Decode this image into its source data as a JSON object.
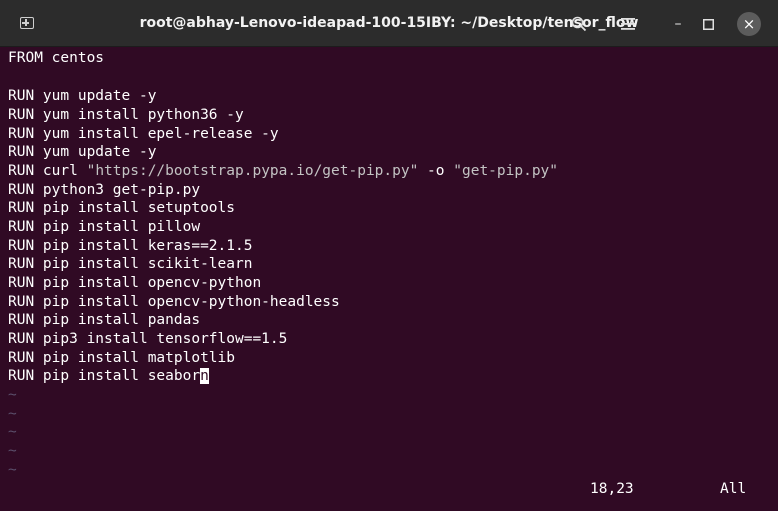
{
  "window": {
    "title": "root@abhay-Lenovo-ideapad-100-15IBY: ~/Desktop/tensor_flow",
    "close_glyph": "×",
    "minimize_glyph": "–",
    "maximize_glyph": "☐"
  },
  "icons": {
    "new_tab": "new-tab-icon",
    "search": "search-icon",
    "menu": "hamburger-menu-icon",
    "minimize": "minimize-icon",
    "maximize": "maximize-icon",
    "close": "close-icon"
  },
  "colors": {
    "terminal_bg": "#300a24",
    "titlebar_bg": "#2c2c2c",
    "string": "#c3c3c3",
    "tilde": "#5a4e6a"
  },
  "editor": {
    "lines": [
      {
        "kw": "FROM",
        "text": " centos"
      },
      {
        "kw": "",
        "text": ""
      },
      {
        "kw": "RUN",
        "text": " yum update -y"
      },
      {
        "kw": "RUN",
        "text": " yum install python36 -y"
      },
      {
        "kw": "RUN",
        "text": " yum install epel-release -y"
      },
      {
        "kw": "RUN",
        "text": " yum update -y"
      },
      {
        "kw": "RUN",
        "text": " curl ",
        "str1": "\"https://bootstrap.pypa.io/get-pip.py\"",
        "mid": " -o ",
        "str2": "\"get-pip.py\""
      },
      {
        "kw": "RUN",
        "text": " python3 get-pip.py"
      },
      {
        "kw": "RUN",
        "text": " pip install setuptools"
      },
      {
        "kw": "RUN",
        "text": " pip install pillow"
      },
      {
        "kw": "RUN",
        "text": " pip install keras==2.1.5"
      },
      {
        "kw": "RUN",
        "text": " pip install scikit-learn"
      },
      {
        "kw": "RUN",
        "text": " pip install opencv-python"
      },
      {
        "kw": "RUN",
        "text": " pip install opencv-python-headless"
      },
      {
        "kw": "RUN",
        "text": " pip install pandas"
      },
      {
        "kw": "RUN",
        "text": " pip3 install tensorflow==1.5"
      },
      {
        "kw": "RUN",
        "text": " pip install matplotlib"
      },
      {
        "kw": "RUN",
        "text": " pip install seabor",
        "cursor": "n"
      }
    ],
    "tildes": [
      "~",
      "~",
      "~",
      "~",
      "~"
    ],
    "cursor_position": "18,23",
    "scroll_position": "All"
  }
}
